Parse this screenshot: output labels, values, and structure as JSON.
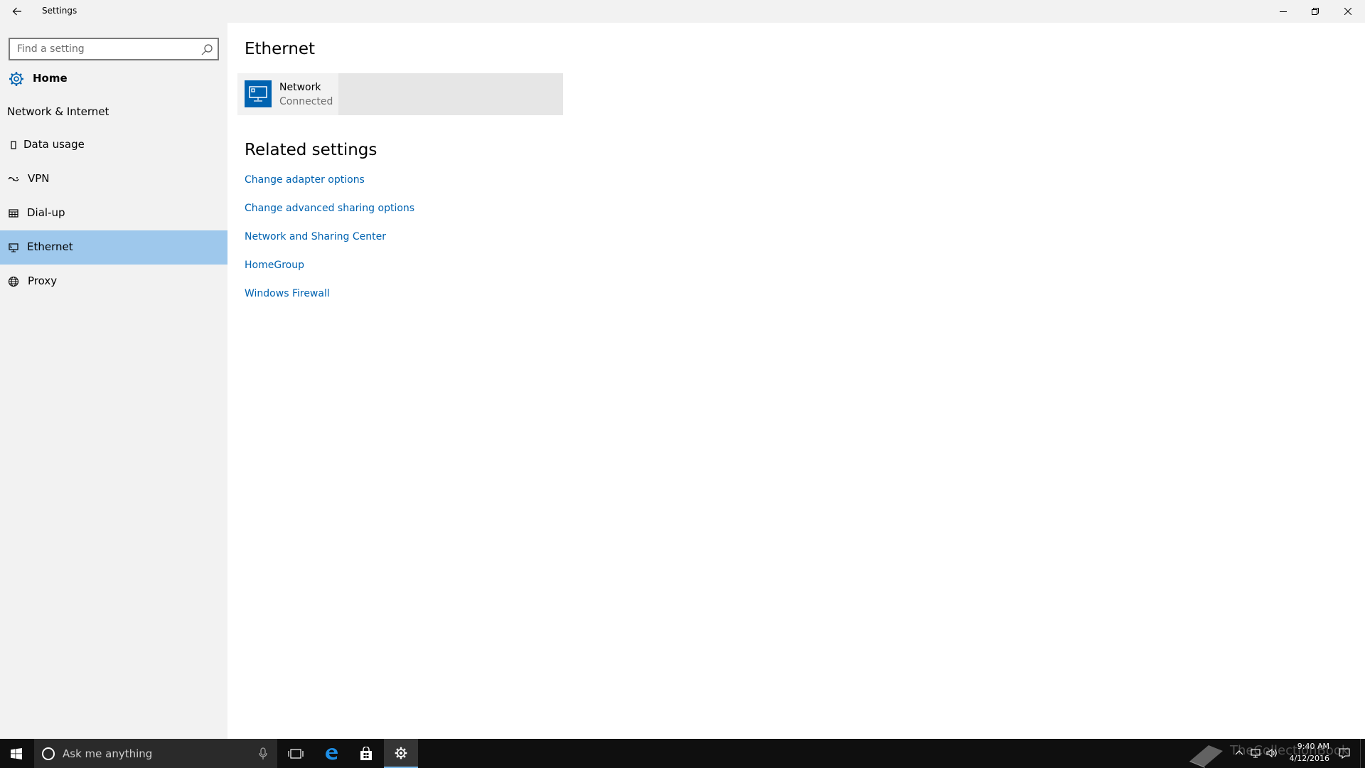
{
  "window": {
    "title": "Settings"
  },
  "sidebar": {
    "search_placeholder": "Find a setting",
    "home_label": "Home",
    "section_label": "Network & Internet",
    "items": [
      {
        "label": "Data usage",
        "icon": "data-usage-icon"
      },
      {
        "label": "VPN",
        "icon": "vpn-icon"
      },
      {
        "label": "Dial-up",
        "icon": "dial-up-icon"
      },
      {
        "label": "Ethernet",
        "icon": "ethernet-icon",
        "selected": true
      },
      {
        "label": "Proxy",
        "icon": "globe-icon"
      }
    ]
  },
  "main": {
    "page_title": "Ethernet",
    "network": {
      "name": "Network",
      "status": "Connected"
    },
    "related_title": "Related settings",
    "links": [
      "Change adapter options",
      "Change advanced sharing options",
      "Network and Sharing Center",
      "HomeGroup",
      "Windows Firewall"
    ]
  },
  "taskbar": {
    "search_placeholder": "Ask me anything",
    "time": "9:40 AM",
    "date": "4/12/2016",
    "watermark": "TheCollectionBook"
  },
  "colors": {
    "accent": "#0063b1",
    "selected_bg": "#9ec8ec",
    "sidebar_bg": "#f2f2f2",
    "taskbar_bg": "#0f0f0f"
  }
}
